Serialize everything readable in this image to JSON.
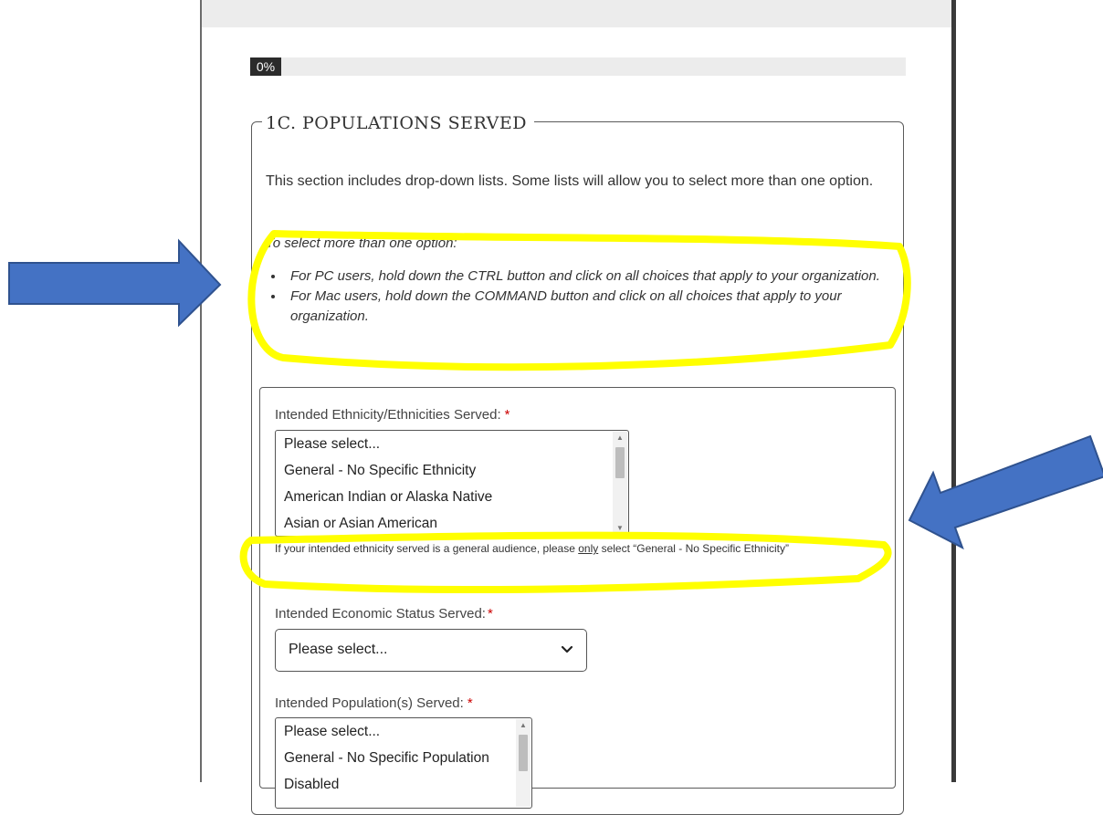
{
  "progress": {
    "label": "0%",
    "value_percent": 0
  },
  "section": {
    "title": "1C. POPULATIONS SERVED",
    "intro": "This section includes drop-down lists. Some lists will allow you to select more than one option.",
    "instructions_title": "To select more than one option:",
    "instructions": [
      "For PC users, hold down the CTRL button and click on all choices that apply to your organization.",
      "For Mac users, hold down the COMMAND button and click on all choices that apply to your organization."
    ]
  },
  "ethnicity": {
    "label": "Intended Ethnicity/Ethnicities Served:",
    "required_mark": "*",
    "options": [
      "Please select...",
      "General - No Specific Ethnicity",
      "American Indian or Alaska Native",
      "Asian or Asian American"
    ],
    "helper_before": "If your intended ethnicity served is a general audience, please ",
    "helper_emph": "only",
    "helper_after": " select “General - No Specific Ethnicity”"
  },
  "economic": {
    "label": "Intended Economic Status Served:",
    "required_mark": "*",
    "selected": "Please select..."
  },
  "population": {
    "label": "Intended Population(s) Served:",
    "required_mark": "*",
    "options": [
      "Please select...",
      "General - No Specific Population",
      "Disabled"
    ]
  },
  "colors": {
    "highlight": "#ffff00",
    "arrow_fill": "#4472c4",
    "arrow_stroke": "#2f528f",
    "required": "#cc0000"
  }
}
